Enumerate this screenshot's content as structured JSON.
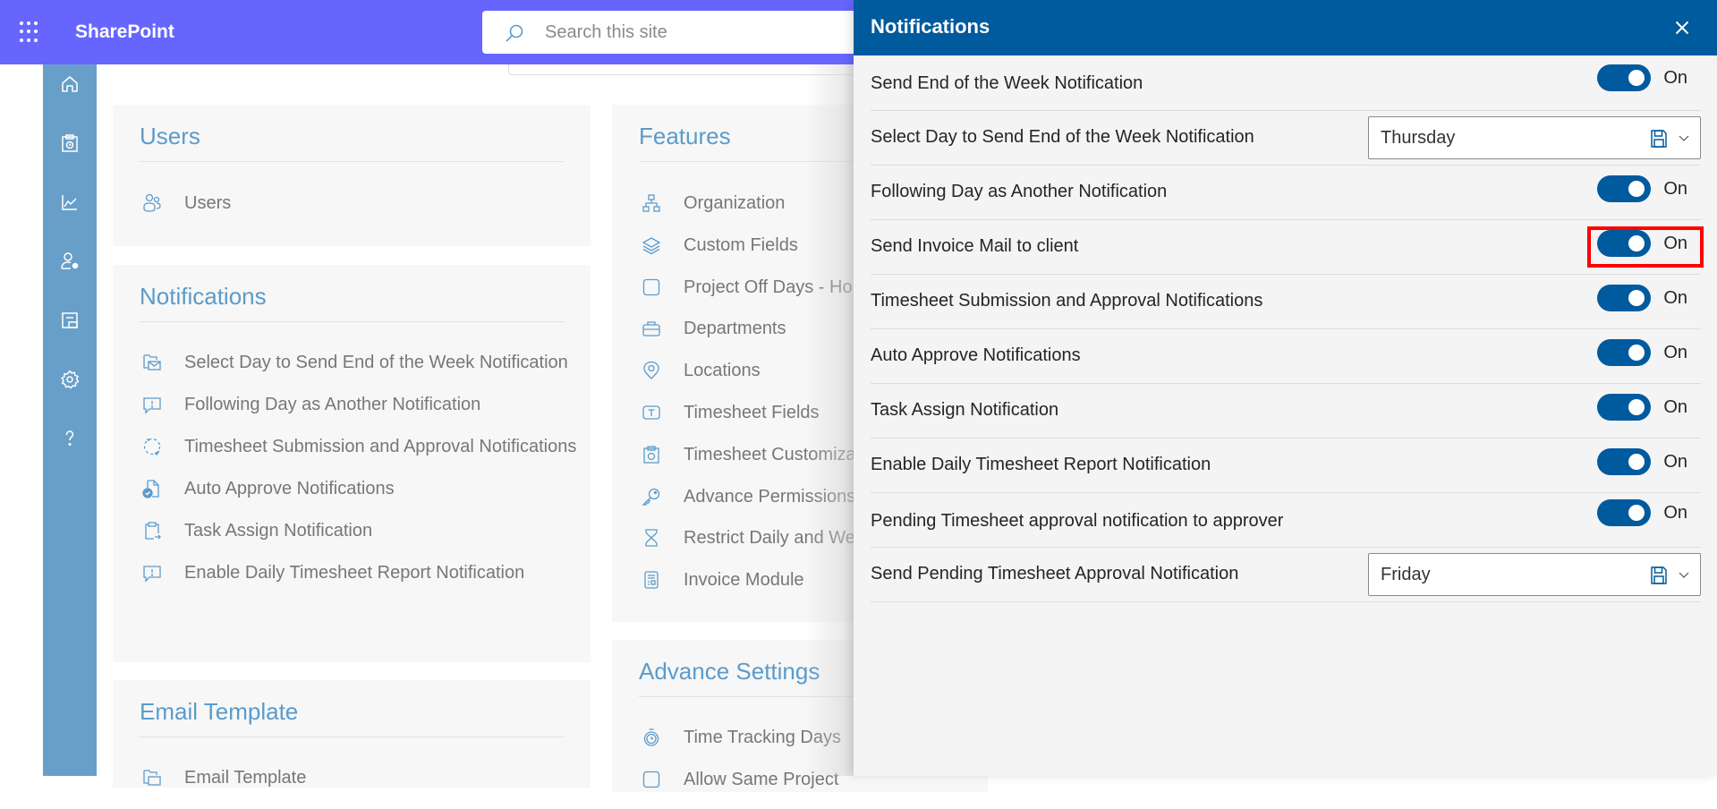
{
  "topbar": {
    "app_name": "SharePoint",
    "search_placeholder": "Search this site"
  },
  "sidebar": {
    "items": [
      {
        "icon": "home-icon",
        "label": "Home"
      },
      {
        "icon": "timesheet-icon",
        "label": "Timesheet"
      },
      {
        "icon": "chart-icon",
        "label": "Reports"
      },
      {
        "icon": "user-settings-icon",
        "label": "User Settings"
      },
      {
        "icon": "layout-icon",
        "label": "Layout"
      },
      {
        "icon": "gear-icon",
        "label": "Settings"
      },
      {
        "icon": "help-icon",
        "label": "Help"
      }
    ]
  },
  "cards": {
    "users": {
      "title": "Users",
      "items": [
        {
          "icon": "users-icon",
          "label": "Users"
        }
      ]
    },
    "notifications": {
      "title": "Notifications",
      "items": [
        {
          "icon": "mail-calendar-icon",
          "label": "Select Day to Send End of the Week Notification"
        },
        {
          "icon": "comment-alert-icon",
          "label": "Following Day as Another Notification"
        },
        {
          "icon": "dashed-circle-check-icon",
          "label": "Timesheet Submission and Approval Notifications"
        },
        {
          "icon": "document-check-icon",
          "label": "Auto Approve Notifications"
        },
        {
          "icon": "clipboard-arrow-icon",
          "label": "Task Assign Notification"
        },
        {
          "icon": "comment-alert-icon",
          "label": "Enable Daily Timesheet Report Notification"
        }
      ]
    },
    "email_template": {
      "title": "Email Template",
      "items": [
        {
          "icon": "mail-calendar-icon",
          "label": "Email Template"
        }
      ]
    },
    "features": {
      "title": "Features",
      "items": [
        {
          "icon": "org-chart-icon",
          "label": "Organization"
        },
        {
          "icon": "layers-icon",
          "label": "Custom Fields"
        },
        {
          "icon": "square-icon",
          "label": "Project Off Days - Ho"
        },
        {
          "icon": "briefcase-icon",
          "label": "Departments"
        },
        {
          "icon": "location-pin-icon",
          "label": "Locations"
        },
        {
          "icon": "text-field-icon",
          "label": "Timesheet Fields"
        },
        {
          "icon": "timesheet-icon",
          "label": "Timesheet Customiza"
        },
        {
          "icon": "key-icon",
          "label": "Advance Permissions"
        },
        {
          "icon": "hourglass-icon",
          "label": "Restrict Daily and We"
        },
        {
          "icon": "invoice-icon",
          "label": "Invoice Module"
        }
      ]
    },
    "advance_settings": {
      "title": "Advance Settings",
      "items": [
        {
          "icon": "stopwatch-icon",
          "label": "Time Tracking Days"
        },
        {
          "icon": "square-icon",
          "label": "Allow Same Project"
        }
      ]
    }
  },
  "panel": {
    "title": "Notifications",
    "close_label": "Close",
    "rows": [
      {
        "label": "Send End of the Week Notification",
        "type": "toggle",
        "state": "On"
      },
      {
        "label": "Select Day to Send End of the Week Notification",
        "type": "dropdown",
        "value": "Thursday"
      },
      {
        "label": "Following Day as Another Notification",
        "type": "toggle",
        "state": "On"
      },
      {
        "label": "Send Invoice Mail to client",
        "type": "toggle",
        "state": "On",
        "highlighted": true
      },
      {
        "label": "Timesheet Submission and Approval Notifications",
        "type": "toggle",
        "state": "On"
      },
      {
        "label": "Auto Approve Notifications",
        "type": "toggle",
        "state": "On"
      },
      {
        "label": "Task Assign Notification",
        "type": "toggle",
        "state": "On"
      },
      {
        "label": "Enable Daily Timesheet Report Notification",
        "type": "toggle",
        "state": "On"
      },
      {
        "label": "Pending Timesheet approval notification to approver",
        "type": "toggle",
        "state": "On"
      },
      {
        "label": "Send Pending Timesheet Approval Notification",
        "type": "dropdown",
        "value": "Friday"
      }
    ]
  },
  "colors": {
    "topbar": "#6666ff",
    "sidebar": "#689fc8",
    "panel_header": "#005a9e",
    "toggle_on": "#005a9e",
    "card_title": "#5b9bcb",
    "highlight": "#ff0000"
  }
}
